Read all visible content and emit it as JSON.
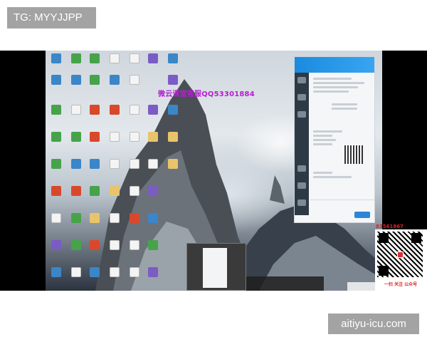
{
  "watermarks": {
    "top_tag": "TG: MYYJJPP",
    "bottom_tag": "aitiyu-icu.com"
  },
  "video": {
    "overlay_text": "微云课堂客服QQ53301884",
    "qr_top_text": "83561867",
    "qr_bottom_text": "一扫 关注 公众号"
  },
  "desktop": {
    "icon_columns": 7,
    "icon_rows": 12
  },
  "colors": {
    "tag_bg": "#a3a3a3",
    "overlay_text": "#b41fd1",
    "qq_header": "#1b8be0",
    "qr_red": "#d22222"
  }
}
